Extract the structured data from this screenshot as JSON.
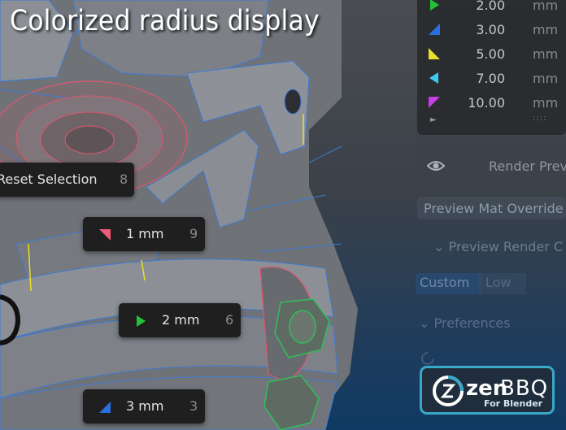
{
  "title": "Colorized radius display",
  "radius_list": {
    "unit": "mm",
    "items": [
      {
        "value": "2.00",
        "color": "#22c33a",
        "shape": "play-triangle"
      },
      {
        "value": "3.00",
        "color": "#2a6fe0",
        "shape": "corner-triangle"
      },
      {
        "value": "5.00",
        "color": "#e8e02a",
        "shape": "corner-triangle"
      },
      {
        "value": "7.00",
        "color": "#3ec9f0",
        "shape": "left-triangle"
      },
      {
        "value": "10.00",
        "color": "#c83ee8",
        "shape": "down-triangle"
      }
    ],
    "grip": "::::"
  },
  "render_preview": {
    "label": "Render Prev",
    "icon": "eye-icon"
  },
  "preview_mat": {
    "label": "Preview Mat Override"
  },
  "preview_render": {
    "label": "Preview Render C"
  },
  "segments": {
    "custom": "Custom",
    "low": "Low"
  },
  "preferences": {
    "label": "Preferences"
  },
  "pie_menu": {
    "reset": {
      "label": "Reset Selection",
      "key": "8"
    },
    "items": [
      {
        "label": "1 mm",
        "key": "9",
        "color": "#f05a78"
      },
      {
        "label": "2 mm",
        "key": "6",
        "color": "#22c33a"
      },
      {
        "label": "3 mm",
        "key": "3",
        "color": "#2a6fe0"
      }
    ]
  },
  "logo": {
    "zen": "zen",
    "bbq": "BBQ",
    "sub": "For Blender"
  }
}
